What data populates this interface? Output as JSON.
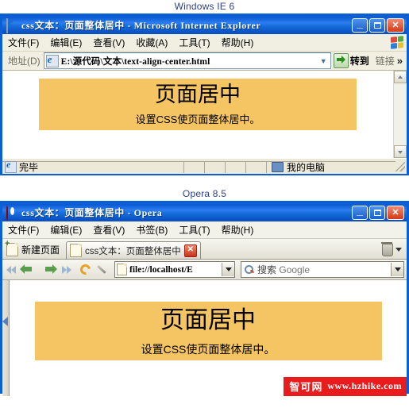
{
  "captions": {
    "ie": "Windows IE 6",
    "opera": "Opera 8.5"
  },
  "colors": {
    "titlebar_blue": "#0a5fd4",
    "center_box": "#f5c463",
    "watermark_red": "#e81c1c",
    "caption_text": "#2b3f8c"
  },
  "ie": {
    "title": "css文本：页面整体居中 - Microsoft Internet Explorer",
    "window_buttons": {
      "minimize": "_",
      "maximize": "□",
      "close": "✕"
    },
    "menu": [
      "文件(F)",
      "编辑(E)",
      "查看(V)",
      "收藏(A)",
      "工具(T)",
      "帮助(H)"
    ],
    "address": {
      "label": "地址(D)",
      "value": "E:\\源代码\\文本\\text-align-center.html",
      "go_label": "转到",
      "links_label": "链接",
      "overflow": "»"
    },
    "page": {
      "heading": "页面居中",
      "subtext": "设置CSS使页面整体居中。"
    },
    "status": {
      "text": "完毕",
      "zone": "我的电脑"
    }
  },
  "opera": {
    "title": "css文本：页面整体居中 - Opera",
    "window_buttons": {
      "minimize": "_",
      "maximize": "□",
      "close": "✕"
    },
    "menu": [
      "文件(F)",
      "编辑(E)",
      "查看(V)",
      "书签(B)",
      "工具(T)",
      "帮助(H)"
    ],
    "tabs": {
      "new_page_label": "新建页面",
      "active_tab_label": "css文本：页面整体居中",
      "close_glyph": "✕"
    },
    "navbar": {
      "address_value": "file://localhost/E",
      "search_label": "搜索",
      "search_engine": "Google"
    },
    "page": {
      "heading": "页面居中",
      "subtext": "设置CSS使页面整体居中。"
    }
  },
  "watermark": {
    "cn": "智可网",
    "url": "www.hzhike.com"
  }
}
